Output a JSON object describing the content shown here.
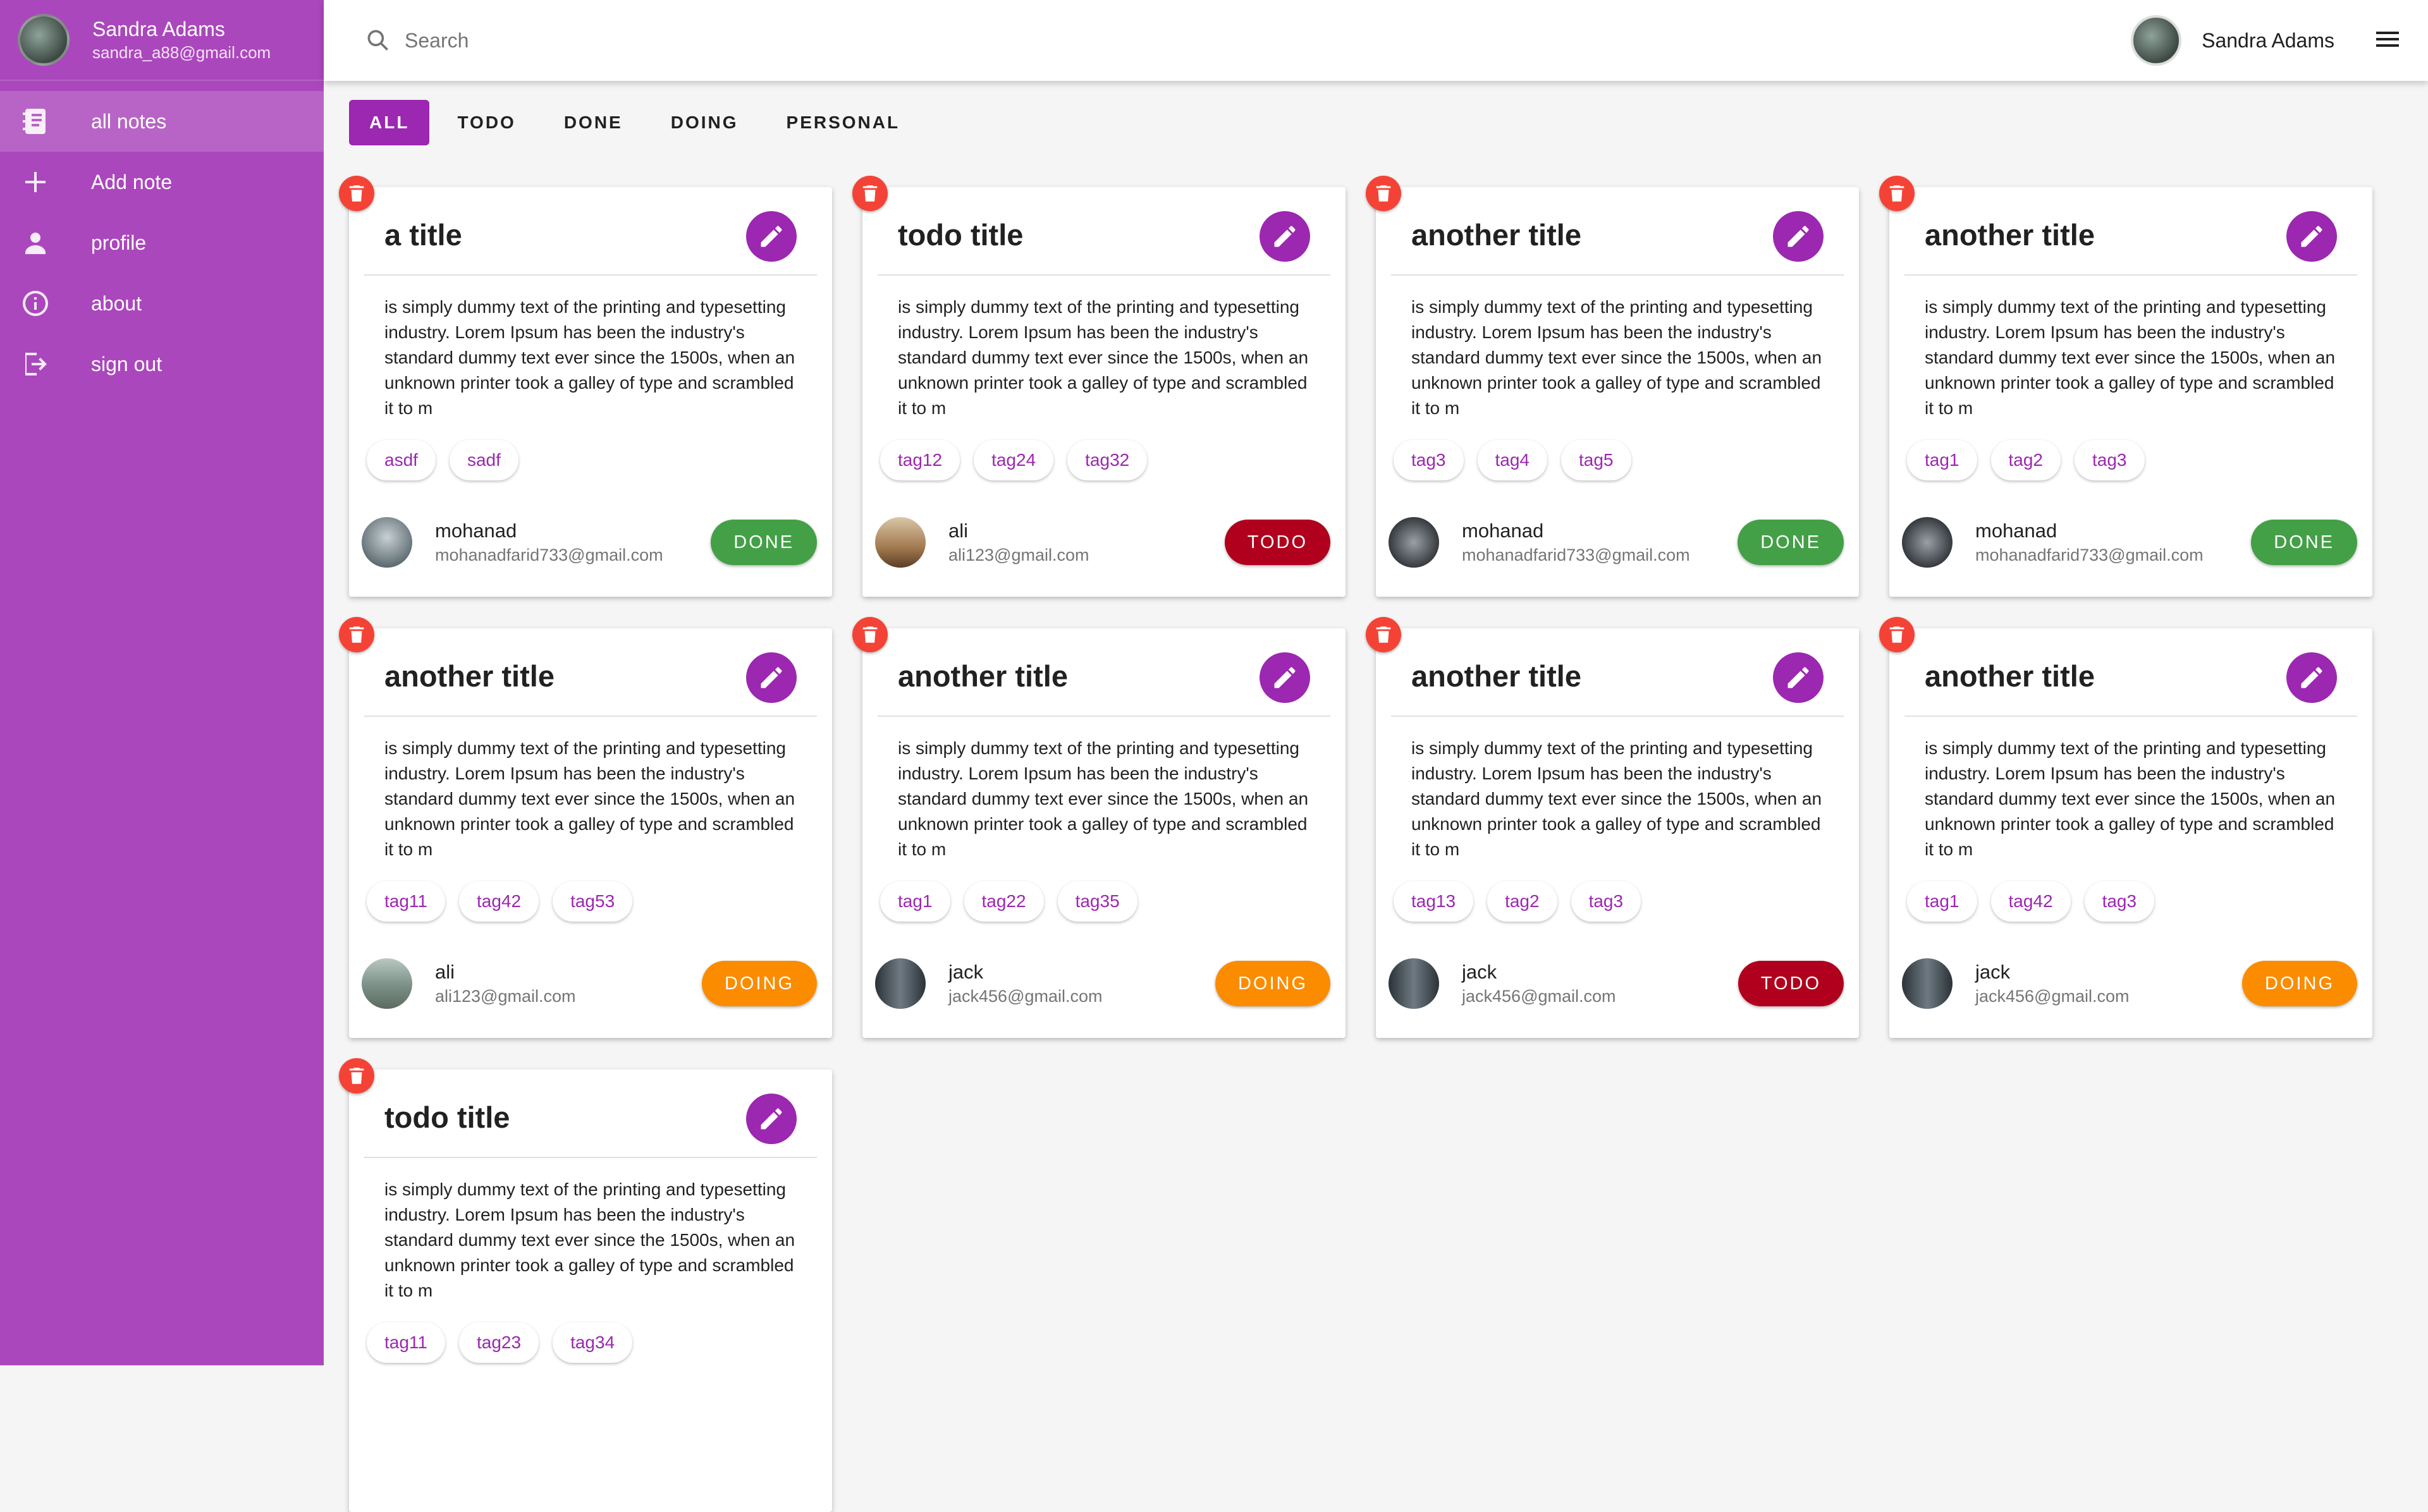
{
  "sidebar": {
    "user": {
      "name": "Sandra Adams",
      "email": "sandra_a88@gmail.com"
    },
    "items": [
      {
        "label": "all notes",
        "icon": "notebook-icon"
      },
      {
        "label": "Add note",
        "icon": "plus-icon"
      },
      {
        "label": "profile",
        "icon": "person-icon"
      },
      {
        "label": "about",
        "icon": "info-icon"
      },
      {
        "label": "sign out",
        "icon": "logout-icon"
      }
    ]
  },
  "header": {
    "search_placeholder": "Search",
    "user_name": "Sandra Adams"
  },
  "tabs": [
    "ALL",
    "TODO",
    "DONE",
    "DOING",
    "PERSONAL"
  ],
  "colors": {
    "purple": "#9c27b0",
    "done": "#43a047",
    "todo": "#b0001e",
    "doing": "#fb8c00",
    "delete": "#f44336"
  },
  "body_text": "is simply dummy text of the printing and typesetting industry. Lorem Ipsum has been the industry's standard dummy text ever since the 1500s, when an unknown printer took a galley of type and scrambled it to m",
  "notes": [
    {
      "title": "a title",
      "body": "is simply dummy text of the printing and typesetting industry. Lorem Ipsum has been the industry's standard dummy text ever since the 1500s, when an unknown printer took a galley of type and scrambled it to m",
      "tags": [
        "asdf",
        "sadf"
      ],
      "author": "mohanad",
      "email": "mohanadfarid733@gmail.com",
      "status": "DONE"
    },
    {
      "title": "todo title",
      "body": "is simply dummy text of the printing and typesetting industry. Lorem Ipsum has been the industry's standard dummy text ever since the 1500s, when an unknown printer took a galley of type and scrambled it to m",
      "tags": [
        "tag12",
        "tag24",
        "tag32"
      ],
      "author": "ali",
      "email": "ali123@gmail.com",
      "status": "TODO"
    },
    {
      "title": "another title",
      "body": "is simply dummy text of the printing and typesetting industry. Lorem Ipsum has been the industry's standard dummy text ever since the 1500s, when an unknown printer took a galley of type and scrambled it to m",
      "tags": [
        "tag3",
        "tag4",
        "tag5"
      ],
      "author": "mohanad",
      "email": "mohanadfarid733@gmail.com",
      "status": "DONE"
    },
    {
      "title": "another title",
      "body": "is simply dummy text of the printing and typesetting industry. Lorem Ipsum has been the industry's standard dummy text ever since the 1500s, when an unknown printer took a galley of type and scrambled it to m",
      "tags": [
        "tag1",
        "tag2",
        "tag3"
      ],
      "author": "mohanad",
      "email": "mohanadfarid733@gmail.com",
      "status": "DONE"
    },
    {
      "title": "another title",
      "body": "is simply dummy text of the printing and typesetting industry. Lorem Ipsum has been the industry's standard dummy text ever since the 1500s, when an unknown printer took a galley of type and scrambled it to m",
      "tags": [
        "tag11",
        "tag42",
        "tag53"
      ],
      "author": "ali",
      "email": "ali123@gmail.com",
      "status": "DOING"
    },
    {
      "title": "another title",
      "body": "is simply dummy text of the printing and typesetting industry. Lorem Ipsum has been the industry's standard dummy text ever since the 1500s, when an unknown printer took a galley of type and scrambled it to m",
      "tags": [
        "tag1",
        "tag22",
        "tag35"
      ],
      "author": "jack",
      "email": "jack456@gmail.com",
      "status": "DOING"
    },
    {
      "title": "another title",
      "body": "is simply dummy text of the printing and typesetting industry. Lorem Ipsum has been the industry's standard dummy text ever since the 1500s, when an unknown printer took a galley of type and scrambled it to m",
      "tags": [
        "tag13",
        "tag2",
        "tag3"
      ],
      "author": "jack",
      "email": "jack456@gmail.com",
      "status": "TODO"
    },
    {
      "title": "another title",
      "body": "is simply dummy text of the printing and typesetting industry. Lorem Ipsum has been the industry's standard dummy text ever since the 1500s, when an unknown printer took a galley of type and scrambled it to m",
      "tags": [
        "tag1",
        "tag42",
        "tag3"
      ],
      "author": "jack",
      "email": "jack456@gmail.com",
      "status": "DOING"
    },
    {
      "title": "todo title",
      "body": "is simply dummy text of the printing and typesetting industry. Lorem Ipsum has been the industry's standard dummy text ever since the 1500s, when an unknown printer took a galley of type and scrambled it to m",
      "tags": [
        "tag11",
        "tag23",
        "tag34"
      ]
    }
  ]
}
